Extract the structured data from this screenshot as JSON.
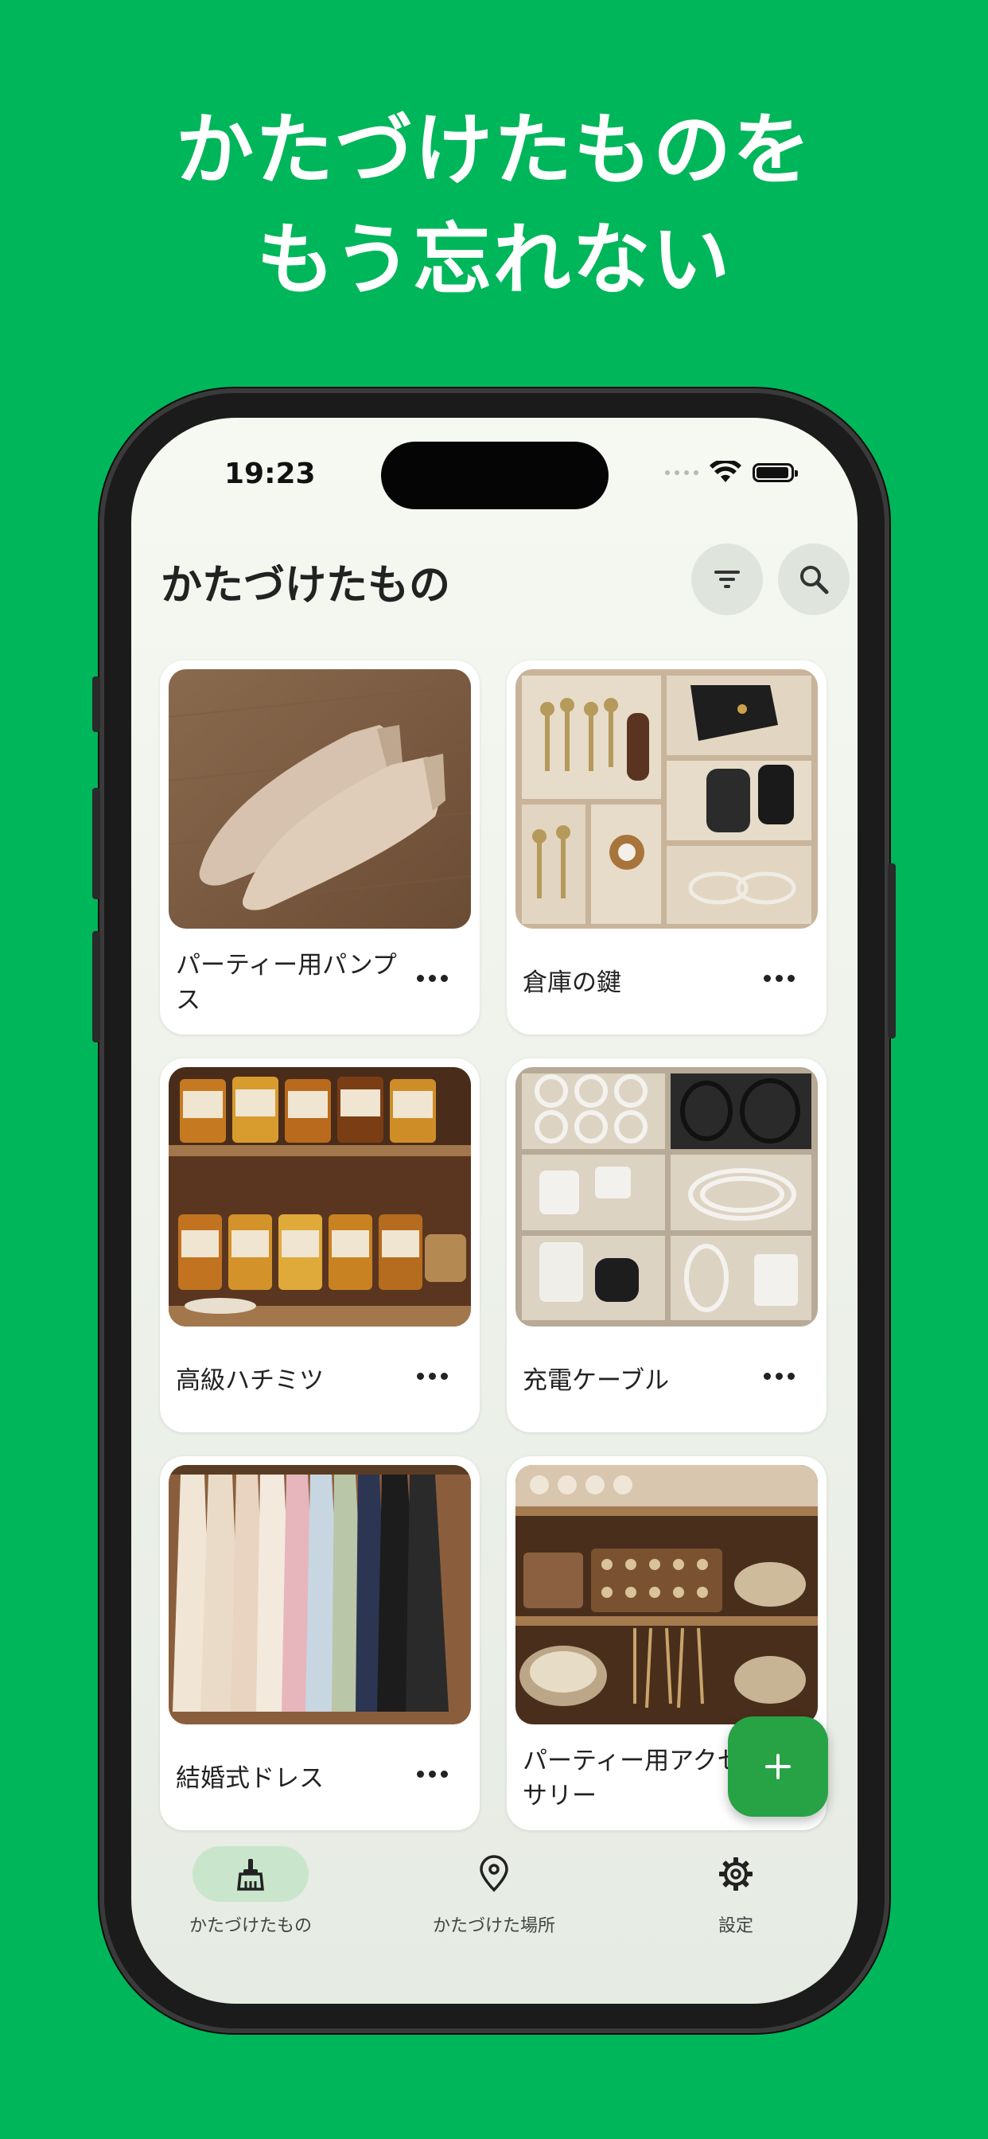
{
  "promo": {
    "headline_line1": "かたづけたものを",
    "headline_line2": "もう忘れない"
  },
  "status_bar": {
    "time": "19:23"
  },
  "app": {
    "title": "かたづけたもの"
  },
  "toolbar": {
    "filter_icon": "filter-icon",
    "search_icon": "search-icon"
  },
  "items": [
    {
      "label": "パーティー用パンプス",
      "photo": "beige suede pumps on wooden floor"
    },
    {
      "label": "倉庫の鍵",
      "photo": "keys and remote in wooden drawer organizer"
    },
    {
      "label": "高級ハチミツ",
      "photo": "honey jars on wooden shelves"
    },
    {
      "label": "充電ケーブル",
      "photo": "charging cables and adapters in drawer"
    },
    {
      "label": "結婚式ドレス",
      "photo": "dresses hanging in closet"
    },
    {
      "label": "パーティー用アクセサリー",
      "photo": "jewelry and accessories on shelves"
    }
  ],
  "fab": {
    "icon": "plus-icon"
  },
  "tabs": [
    {
      "label": "かたづけたもの",
      "icon": "broom-icon",
      "active": true
    },
    {
      "label": "かたづけた場所",
      "icon": "location-pin-icon",
      "active": false
    },
    {
      "label": "設定",
      "icon": "gear-icon",
      "active": false
    }
  ],
  "colors": {
    "brand_background": "#00b65a",
    "fab": "#27a346",
    "active_tab_pill": "#c9e6cd"
  }
}
